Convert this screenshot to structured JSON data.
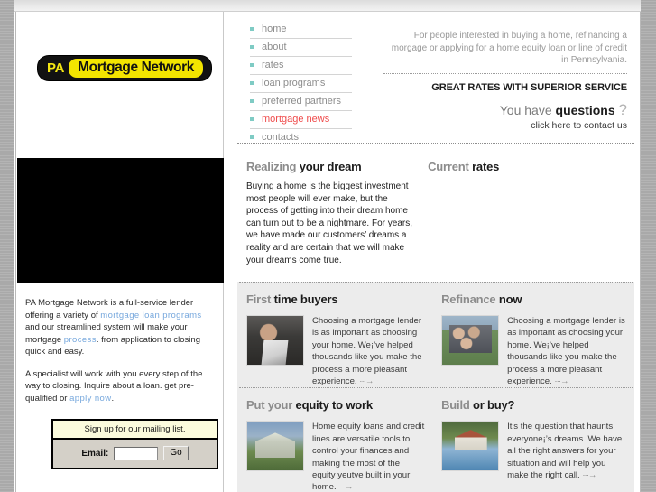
{
  "brand": {
    "logo_prefix": "PA",
    "logo_name": "Mortgage Network",
    "logo_bg": "#121212",
    "logo_yellow": "#f3e500"
  },
  "nav": {
    "items": [
      {
        "label": "home",
        "active": false
      },
      {
        "label": "about",
        "active": false
      },
      {
        "label": "rates",
        "active": false
      },
      {
        "label": "loan programs",
        "active": false
      },
      {
        "label": "preferred partners",
        "active": false
      },
      {
        "label": "mortgage news",
        "active": true
      },
      {
        "label": "contacts",
        "active": false
      }
    ],
    "bullet_color": "#7fcbc4",
    "active_color": "#ef4b4b"
  },
  "header": {
    "blurb": "For people interested in buying a home, refinancing a morgage or applying for a home equity loan or line of credit in Pennsylvania.",
    "tagline": "GREAT RATES WITH SUPERIOR SERVICE",
    "questions_light": "You have",
    "questions_bold": "questions",
    "questions_mark": "?",
    "contact_link": "click here to contact us"
  },
  "sidebar": {
    "intro_p1_a": "PA Mortgage Network is a full-service lender offering a variety of ",
    "intro_link1": "mortgage loan programs",
    "intro_p1_b": " and our streamlined system will make your mortgage ",
    "intro_link2": "process",
    "intro_p1_c": ". from application to closing quick and easy.",
    "intro_p2_a": "A specialist will work with you every step of the way to closing. Inquire about a loan. get pre-qualified or ",
    "intro_link3": "apply now",
    "intro_p2_b": ".",
    "mailing": {
      "heading": "Sign up for our mailing list.",
      "email_label": "Email:",
      "email_value": "",
      "email_placeholder": "",
      "go_label": "Go"
    }
  },
  "main": {
    "dream": {
      "head_light": "Realizing",
      "head_bold": "your dream",
      "text": "Buying a home is the biggest investment most people will ever make, but the process of getting into their dream home can turn out to be a nightmare. For years, we have made our customers’ dreams a reality and are certain that we will make your dreams come true."
    },
    "rates": {
      "head_light": "Current",
      "head_bold": "rates",
      "body": ""
    },
    "cards": [
      {
        "head_light": "First",
        "head_bold": "time buyers",
        "thumb": "office-desk-photo",
        "text": "Choosing a mortgage lender is as important as choosing your home. We¡’ve helped thousands like you make the process a more pleasant experience.",
        "more": "···→"
      },
      {
        "head_light": "Refinance",
        "head_bold": "now",
        "thumb": "family-outside-house-photo",
        "text": "Choosing a mortgage lender is as important as choosing your home. We¡’ve helped thousands like you make the process a more pleasant experience.",
        "more": "···→"
      },
      {
        "head_light": "Put your",
        "head_bold": "equity to work",
        "thumb": "white-house-photo",
        "text": "Home equity loans and credit lines are versatile tools to control your finances and making the most of the equity yeutve built in your home.",
        "more": "···→"
      },
      {
        "head_light": "Build",
        "head_bold": "or buy?",
        "thumb": "house-with-pool-photo",
        "text": "It's the question that haunts everyone¡’s dreams. We have all the right answers for your situation and will help you make the right call.",
        "more": "···→"
      }
    ]
  }
}
